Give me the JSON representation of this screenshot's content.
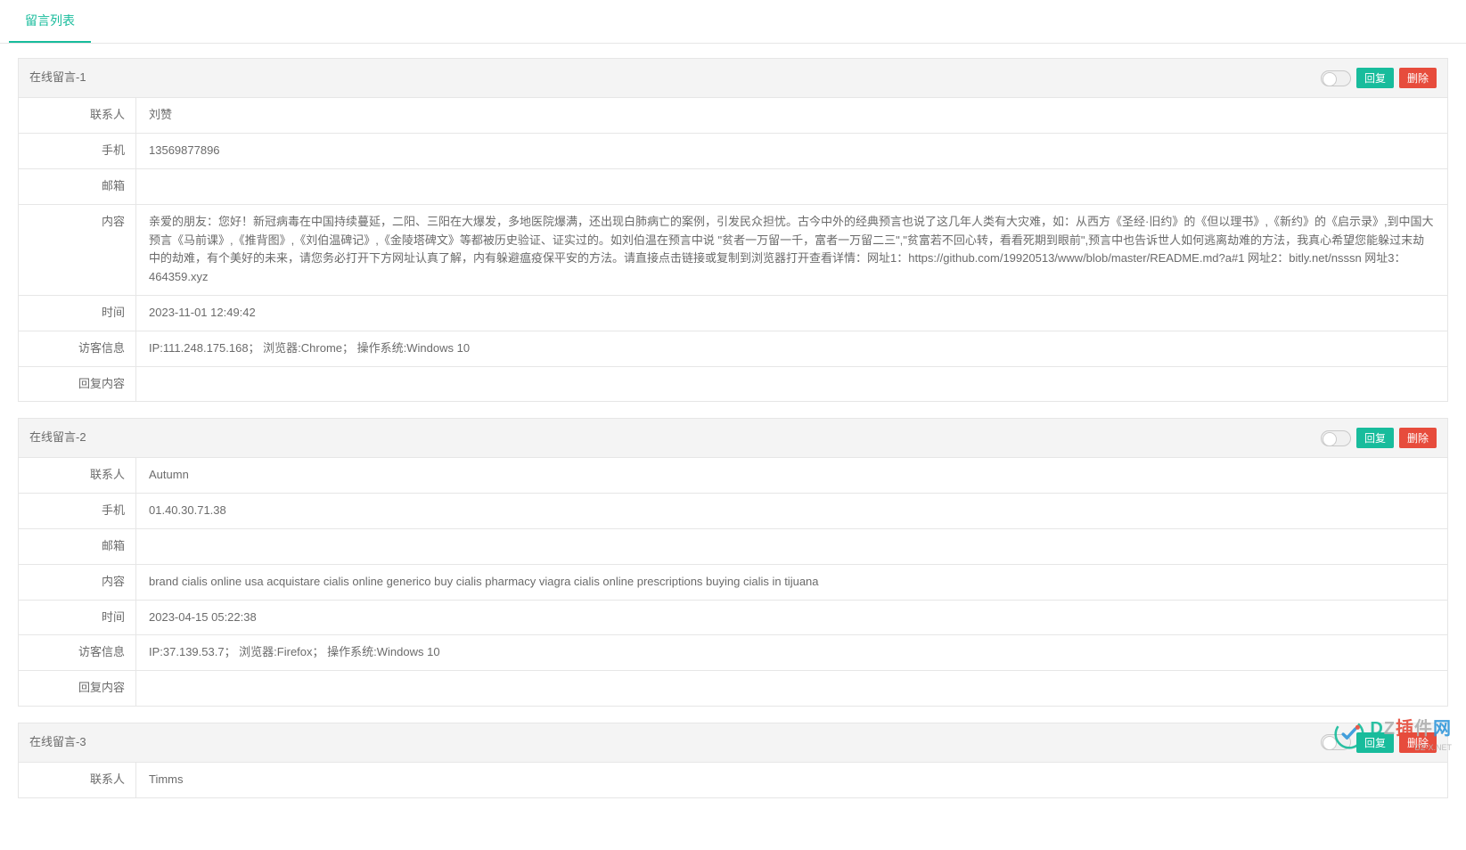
{
  "tabs": {
    "active_label": "留言列表"
  },
  "buttons": {
    "reply": "回复",
    "delete": "删除"
  },
  "fields": {
    "contact": "联系人",
    "phone": "手机",
    "email": "邮箱",
    "content": "内容",
    "time": "时间",
    "visitor": "访客信息",
    "reply_content": "回复内容"
  },
  "messages": [
    {
      "title": "在线留言-1",
      "contact": "刘赞",
      "phone": "13569877896",
      "email": "",
      "content": "亲爱的朋友：您好！新冠病毒在中国持续蔓延，二阳、三阳在大爆发，多地医院爆满，还出现白肺病亡的案例，引发民众担忧。古今中外的经典预言也说了这几年人类有大灾难，如：从西方《圣经·旧约》的《但以理书》,《新约》的《启示录》,到中国大预言《马前课》,《推背图》,《刘伯温碑记》,《金陵塔碑文》等都被历史验证、证实过的。如刘伯温在预言中说 \"贫者一万留一千，富者一万留二三\",\"贫富若不回心转，看看死期到眼前\",预言中也告诉世人如何逃离劫难的方法，我真心希望您能躲过末劫中的劫难，有个美好的未来，请您务必打开下方网址认真了解，内有躲避瘟疫保平安的方法。请直接点击链接或复制到浏览器打开查看详情：网址1：https://github.com/19920513/www/blob/master/README.md?a#1 网址2：bitly.net/nsssn 网址3：464359.xyz",
      "time": "2023-11-01 12:49:42",
      "visitor": "IP:111.248.175.168；  浏览器:Chrome；  操作系统:Windows 10",
      "reply_content": ""
    },
    {
      "title": "在线留言-2",
      "contact": "Autumn",
      "phone": "01.40.30.71.38",
      "email": "",
      "content": "brand cialis online usa acquistare cialis online generico buy cialis pharmacy viagra cialis online prescriptions buying cialis in tijuana",
      "time": "2023-04-15 05:22:38",
      "visitor": "IP:37.139.53.7；  浏览器:Firefox；  操作系统:Windows 10",
      "reply_content": ""
    },
    {
      "title": "在线留言-3",
      "contact": "Timms",
      "phone": "",
      "email": "",
      "content": "",
      "time": "",
      "visitor": "",
      "reply_content": ""
    }
  ],
  "watermark": {
    "main": "DZ插件网",
    "sub": "DZ-X.NET"
  }
}
